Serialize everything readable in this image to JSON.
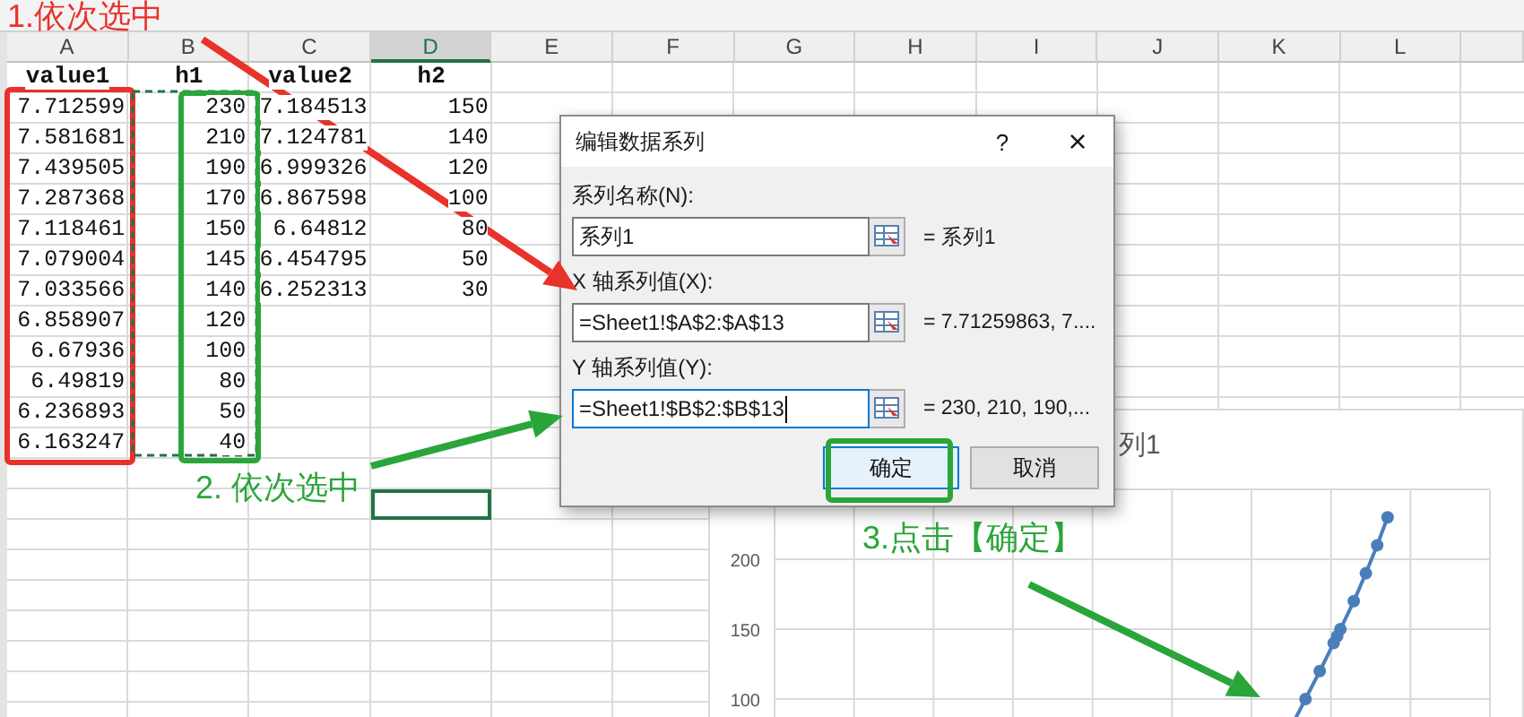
{
  "sheet": {
    "columns": [
      {
        "label": "A",
        "selected": false
      },
      {
        "label": "B",
        "selected": false
      },
      {
        "label": "C",
        "selected": false
      },
      {
        "label": "D",
        "selected": true
      },
      {
        "label": "E",
        "selected": false
      },
      {
        "label": "F",
        "selected": false
      },
      {
        "label": "G",
        "selected": false
      },
      {
        "label": "H",
        "selected": false
      },
      {
        "label": "I",
        "selected": false
      },
      {
        "label": "J",
        "selected": false
      },
      {
        "label": "K",
        "selected": false
      },
      {
        "label": "L",
        "selected": false
      }
    ],
    "rows": [
      {
        "kind": "header",
        "cells": [
          "value1",
          "h1",
          "value2",
          "h2"
        ]
      },
      {
        "kind": "data",
        "cells": [
          "7.712599",
          "230",
          "7.184513",
          "150"
        ]
      },
      {
        "kind": "data",
        "cells": [
          "7.581681",
          "210",
          "7.124781",
          "140"
        ]
      },
      {
        "kind": "data",
        "cells": [
          "7.439505",
          "190",
          "6.999326",
          "120"
        ]
      },
      {
        "kind": "data",
        "cells": [
          "7.287368",
          "170",
          "6.867598",
          "100"
        ]
      },
      {
        "kind": "data",
        "cells": [
          "7.118461",
          "150",
          "6.64812",
          "80"
        ]
      },
      {
        "kind": "data",
        "cells": [
          "7.079004",
          "145",
          "6.454795",
          "50"
        ]
      },
      {
        "kind": "data",
        "cells": [
          "7.033566",
          "140",
          "6.252313",
          "30"
        ]
      },
      {
        "kind": "data",
        "cells": [
          "6.858907",
          "120"
        ]
      },
      {
        "kind": "data",
        "cells": [
          "6.67936",
          "100"
        ]
      },
      {
        "kind": "data",
        "cells": [
          "6.49819",
          "80"
        ]
      },
      {
        "kind": "data",
        "cells": [
          "6.236893",
          "50"
        ]
      },
      {
        "kind": "data",
        "cells": [
          "6.163247",
          "40"
        ]
      }
    ]
  },
  "chart": {
    "title": "列1",
    "y_axis_labels": [
      "200",
      "150",
      "100"
    ]
  },
  "dialog": {
    "title": "编辑数据系列",
    "help": "?",
    "close": "×",
    "fields": [
      {
        "label": "系列名称(N):",
        "value": "系列1",
        "preview": "= 系列1",
        "focused": false
      },
      {
        "label": "X 轴系列值(X):",
        "value": "=Sheet1!$A$2:$A$13",
        "preview": "= 7.71259863, 7....",
        "focused": false
      },
      {
        "label": "Y 轴系列值(Y):",
        "value": "=Sheet1!$B$2:$B$13",
        "preview": "= 230, 210, 190,...",
        "focused": true
      }
    ],
    "buttons": [
      {
        "label": "确定",
        "default": true
      },
      {
        "label": "取消",
        "default": false
      }
    ]
  },
  "annotations": [
    {
      "text": "1.依次选中",
      "color": "#e8322a"
    },
    {
      "text": "2. 依次选中",
      "color": "#2aa53a"
    },
    {
      "text": "3.点击【确定】",
      "color": "#2aa53a"
    }
  ]
}
